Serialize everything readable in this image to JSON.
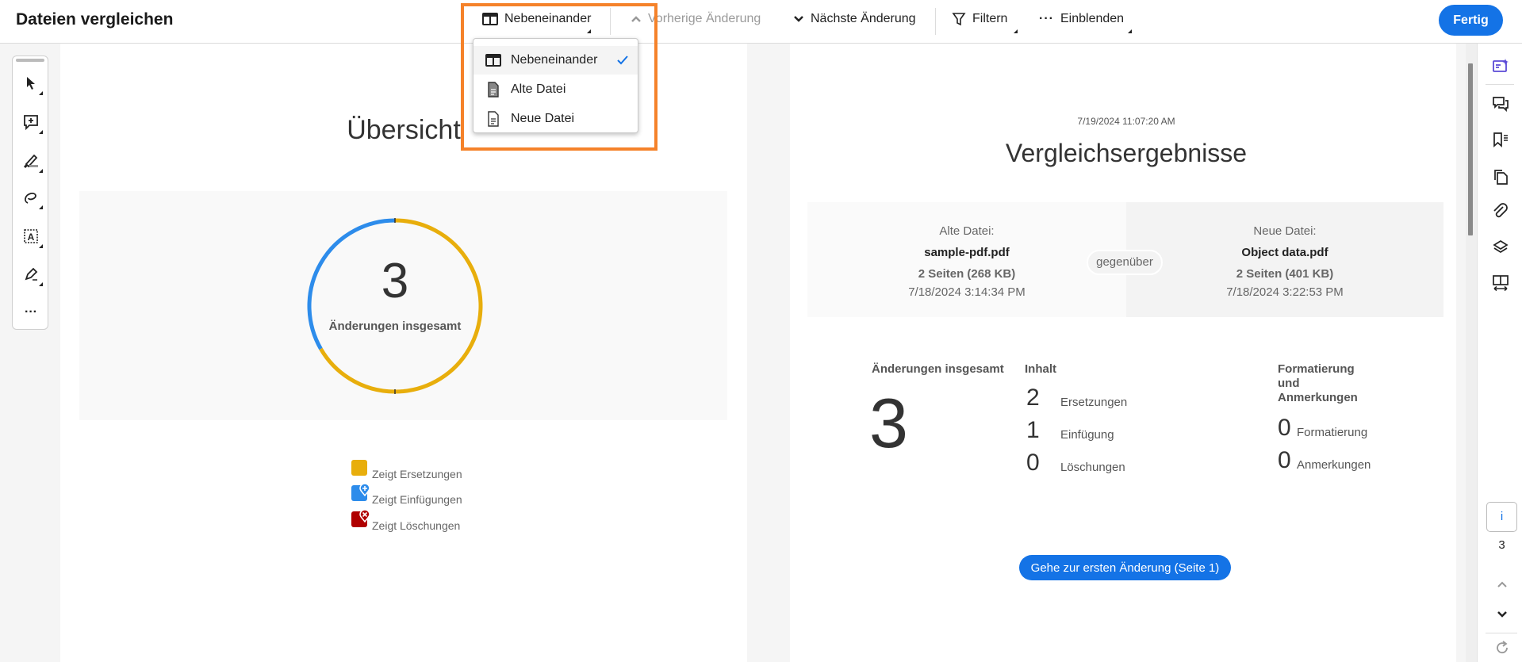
{
  "header": {
    "title": "Dateien vergleichen",
    "view_label": "Nebeneinander",
    "prev_label": "Vorherige Änderung",
    "next_label": "Nächste Änderung",
    "filter_label": "Filtern",
    "show_label": "Einblenden",
    "done_label": "Fertig"
  },
  "view_menu": {
    "items": [
      {
        "label": "Nebeneinander",
        "selected": true
      },
      {
        "label": "Alte Datei",
        "selected": false
      },
      {
        "label": "Neue Datei",
        "selected": false
      }
    ]
  },
  "left_page": {
    "title": "Übersicht",
    "total": "3",
    "total_label": "Änderungen insgesamt",
    "legend": [
      {
        "label": "Zeigt Ersetzungen",
        "color": "#e8ae0c"
      },
      {
        "label": "Zeigt Einfügungen",
        "color": "#2d8ceb"
      },
      {
        "label": "Zeigt Löschungen",
        "color": "#b00000"
      }
    ]
  },
  "chart_data": {
    "type": "pie",
    "title": "Übersicht",
    "categories": [
      "Ersetzungen",
      "Einfügungen",
      "Löschungen"
    ],
    "values": [
      2,
      1,
      0
    ],
    "colors": [
      "#e8ae0c",
      "#2d8ceb",
      "#b00000"
    ]
  },
  "right_page": {
    "timestamp": "7/19/2024 11:07:20 AM",
    "title": "Vergleichsergebnisse",
    "old_file": {
      "heading": "Alte Datei:",
      "name": "sample-pdf.pdf",
      "pages": "2 Seiten (268 KB)",
      "date": "7/18/2024 3:14:34 PM"
    },
    "versus": "gegenüber",
    "new_file": {
      "heading": "Neue Datei:",
      "name": "Object data.pdf",
      "pages": "2 Seiten (401 KB)",
      "date": "7/18/2024 3:22:53 PM"
    },
    "total_heading": "Änderungen insgesamt",
    "total": "3",
    "content_heading": "Inhalt",
    "content": [
      {
        "n": "2",
        "label": "Ersetzungen"
      },
      {
        "n": "1",
        "label": "Einfügung"
      },
      {
        "n": "0",
        "label": "Löschungen"
      }
    ],
    "format_heading": "Formatierung und Anmerkungen",
    "format": [
      {
        "n": "0",
        "label": "Formatierung"
      },
      {
        "n": "0",
        "label": "Anmerkungen"
      }
    ],
    "goto_button": "Gehe zur ersten Änderung (Seite 1)"
  },
  "right_sidebar": {
    "info": "i",
    "count": "3"
  }
}
